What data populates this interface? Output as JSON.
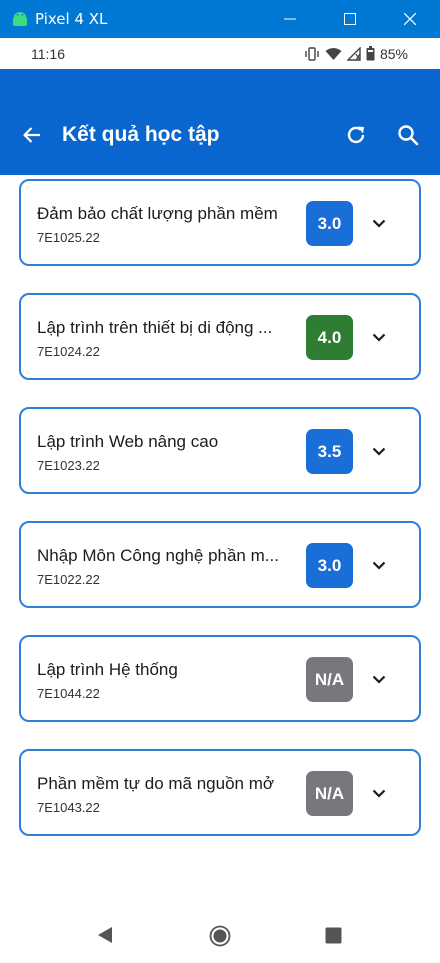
{
  "window": {
    "title": "Pixel 4 XL"
  },
  "status_bar": {
    "time": "11:16",
    "battery": "85%"
  },
  "app_bar": {
    "title": "Kết quả học tập"
  },
  "colors": {
    "app_bar": "#0a66cf",
    "card_border": "#2f7fd9",
    "grade_blue": "#1a6ed8",
    "grade_green": "#2e7d32",
    "grade_na": "#7a767d"
  },
  "courses": [
    {
      "name": "Đảm bảo chất lượng phần mềm",
      "code": "7E1025.22",
      "grade": "3.0",
      "grade_color": "#1a6ed8"
    },
    {
      "name": "Lập trình trên thiết bị di động ...",
      "code": "7E1024.22",
      "grade": "4.0",
      "grade_color": "#2e7d32"
    },
    {
      "name": "Lập trình Web nâng cao",
      "code": "7E1023.22",
      "grade": "3.5",
      "grade_color": "#1a6ed8"
    },
    {
      "name": "Nhập Môn Công nghệ phần m...",
      "code": "7E1022.22",
      "grade": "3.0",
      "grade_color": "#1a6ed8"
    },
    {
      "name": "Lập trình Hệ thống",
      "code": "7E1044.22",
      "grade": "N/A",
      "grade_color": "#7a767d"
    },
    {
      "name": "Phần mềm tự do mã nguồn mở",
      "code": "7E1043.22",
      "grade": "N/A",
      "grade_color": "#7a767d"
    }
  ]
}
